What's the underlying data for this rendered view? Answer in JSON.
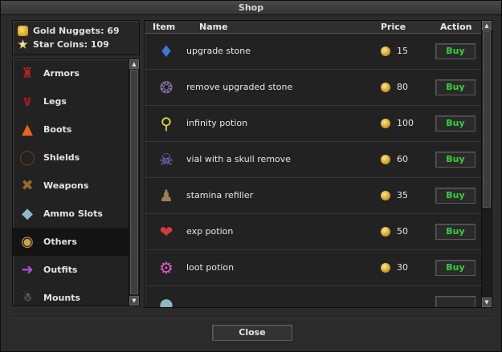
{
  "window": {
    "title": "Shop"
  },
  "currency": {
    "gold_label": "Gold Nuggets: 69",
    "star_label": "Star Coins: 109"
  },
  "categories": [
    {
      "label": "Armors",
      "icon": "armor-icon"
    },
    {
      "label": "Legs",
      "icon": "legs-icon"
    },
    {
      "label": "Boots",
      "icon": "boots-icon"
    },
    {
      "label": "Shields",
      "icon": "shield-icon"
    },
    {
      "label": "Weapons",
      "icon": "crossbow-icon"
    },
    {
      "label": "Ammo Slots",
      "icon": "ammo-slot-icon"
    },
    {
      "label": "Others",
      "icon": "others-icon",
      "selected": true
    },
    {
      "label": "Outfits",
      "icon": "outfit-icon"
    },
    {
      "label": "Mounts",
      "icon": "mount-icon"
    }
  ],
  "table": {
    "headers": {
      "item": "Item",
      "name": "Name",
      "price": "Price",
      "action": "Action"
    },
    "rows": [
      {
        "name": "upgrade stone",
        "price": "15",
        "action": "Buy",
        "icon": "upgrade-stone-icon"
      },
      {
        "name": "remove upgraded stone",
        "price": "80",
        "action": "Buy",
        "icon": "remove-stone-icon"
      },
      {
        "name": "infinity potion",
        "price": "100",
        "action": "Buy",
        "icon": "infinity-potion-icon"
      },
      {
        "name": "vial with a skull remove",
        "price": "60",
        "action": "Buy",
        "icon": "skull-vial-icon"
      },
      {
        "name": "stamina refiller",
        "price": "35",
        "action": "Buy",
        "icon": "stamina-refiller-icon"
      },
      {
        "name": "exp potion",
        "price": "50",
        "action": "Buy",
        "icon": "exp-potion-icon"
      },
      {
        "name": "loot potion",
        "price": "30",
        "action": "Buy",
        "icon": "loot-potion-icon"
      }
    ]
  },
  "footer": {
    "close_label": "Close"
  },
  "colors": {
    "buy_text": "#34d23a",
    "panel": "#222222",
    "selected_row": "#141414"
  }
}
